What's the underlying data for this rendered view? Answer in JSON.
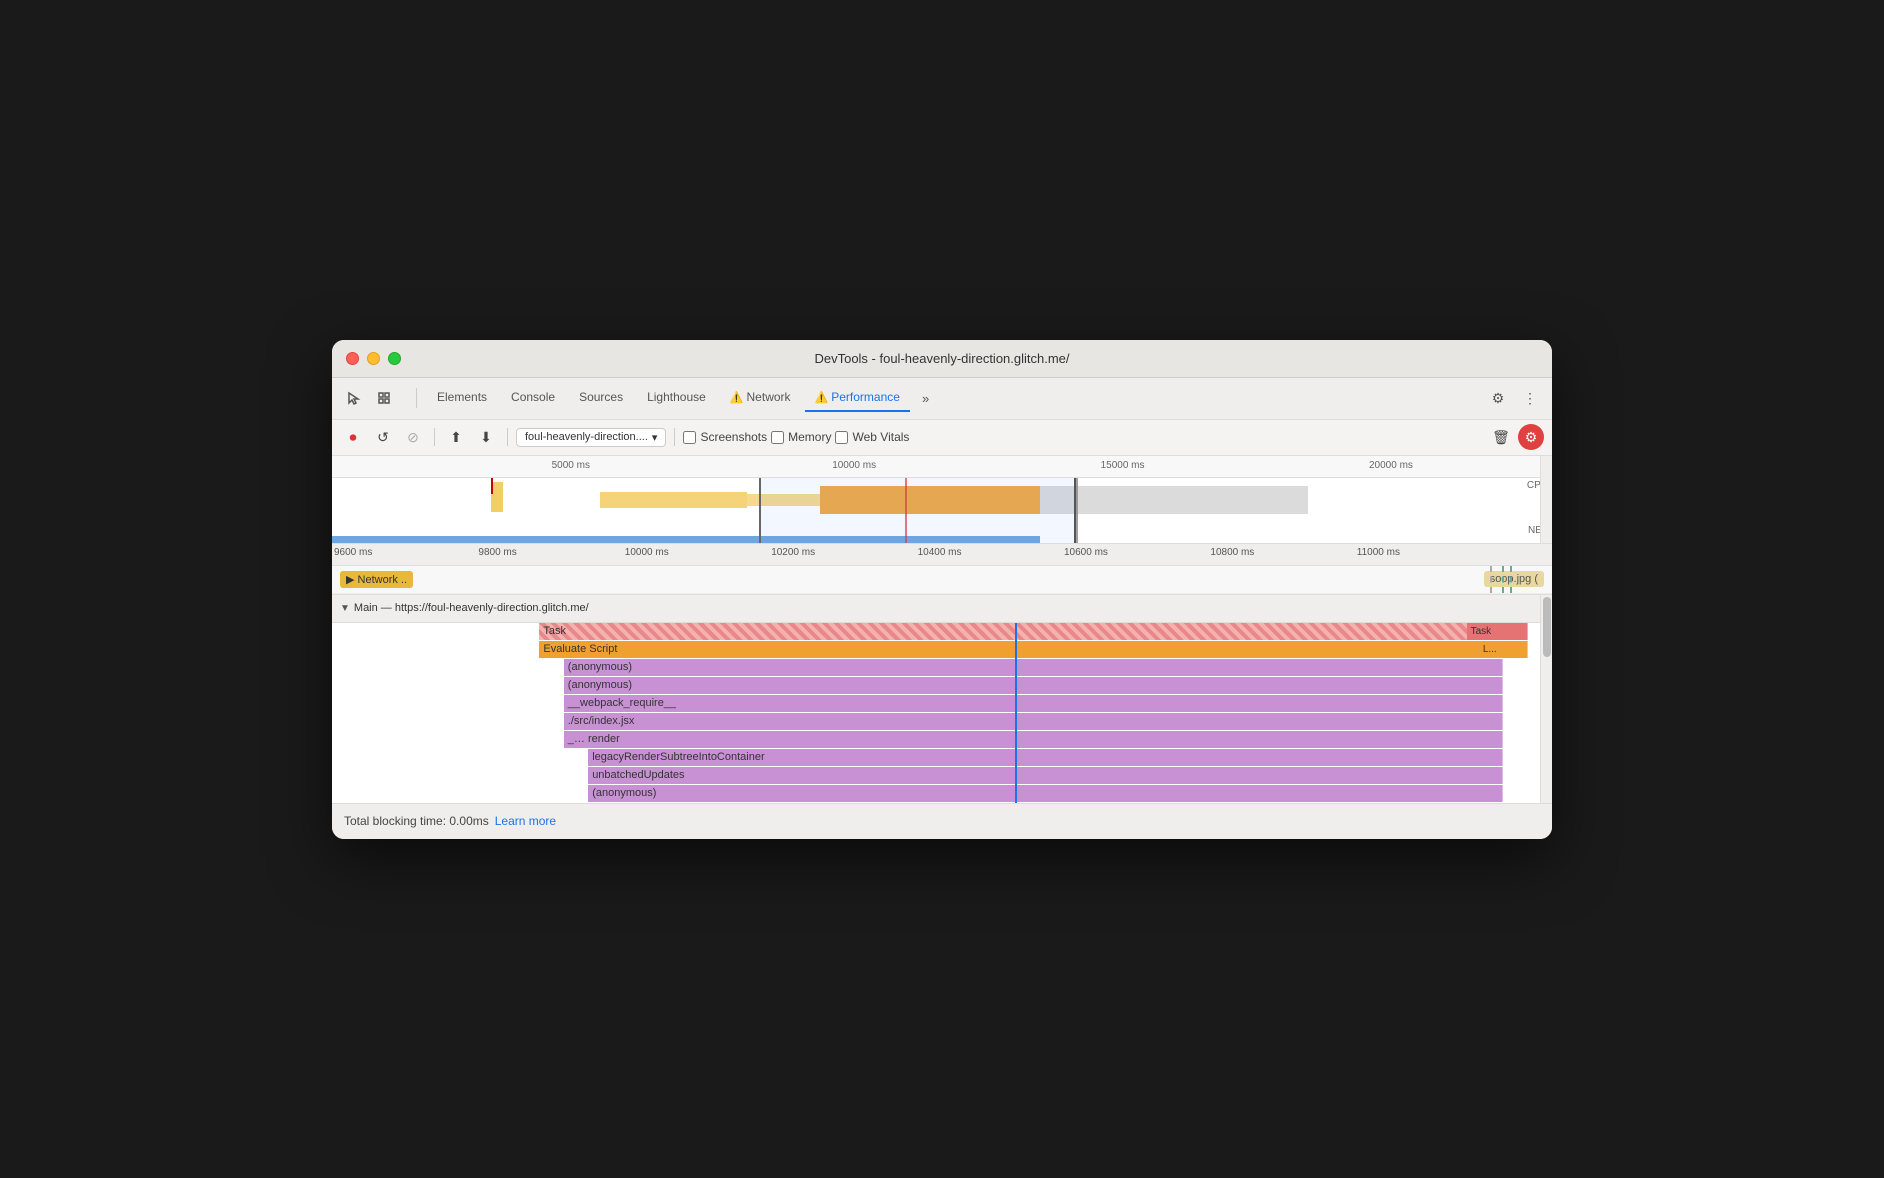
{
  "window": {
    "title": "DevTools - foul-heavenly-direction.glitch.me/"
  },
  "nav": {
    "tabs": [
      {
        "id": "elements",
        "label": "Elements",
        "active": false,
        "warning": false
      },
      {
        "id": "console",
        "label": "Console",
        "active": false,
        "warning": false
      },
      {
        "id": "sources",
        "label": "Sources",
        "active": false,
        "warning": false
      },
      {
        "id": "lighthouse",
        "label": "Lighthouse",
        "active": false,
        "warning": false
      },
      {
        "id": "network",
        "label": "Network",
        "active": false,
        "warning": true
      },
      {
        "id": "performance",
        "label": "Performance",
        "active": true,
        "warning": true
      }
    ],
    "more_label": "»"
  },
  "toolbar": {
    "url": "foul-heavenly-direction....",
    "screenshots_label": "Screenshots",
    "memory_label": "Memory",
    "web_vitals_label": "Web Vitals"
  },
  "timeline": {
    "ruler_labels": [
      "5000 ms",
      "10000 ms",
      "15000 ms",
      "20000 ms"
    ],
    "detail_ruler_labels": [
      "9600 ms",
      "9800 ms",
      "10000 ms",
      "10200 ms",
      "10400 ms",
      "10600 ms",
      "10800 ms",
      "11000 ms"
    ],
    "network_label": "▶ Network ..",
    "network_right_label": "soop.jpg (",
    "cpu_label": "CPU",
    "net_label": "NET"
  },
  "main": {
    "header": "Main — https://foul-heavenly-direction.glitch.me/",
    "rows": [
      {
        "label": "Task",
        "type": "task",
        "depth": 0
      },
      {
        "label": "Evaluate Script",
        "type": "evaluate",
        "depth": 1
      },
      {
        "label": "(anonymous)",
        "type": "call",
        "depth": 2
      },
      {
        "label": "(anonymous)",
        "type": "call",
        "depth": 2
      },
      {
        "label": "__webpack_require__",
        "type": "call",
        "depth": 2
      },
      {
        "label": "./src/index.jsx",
        "type": "call",
        "depth": 2
      },
      {
        "label": "_…  render",
        "type": "call",
        "depth": 2
      },
      {
        "label": "legacyRenderSubtreeIntoContainer",
        "type": "call",
        "depth": 3
      },
      {
        "label": "unbatchedUpdates",
        "type": "call",
        "depth": 3
      },
      {
        "label": "(anonymous)",
        "type": "call",
        "depth": 3
      }
    ],
    "task_right_label": "Task",
    "evaluate_right_label": "L..."
  },
  "status": {
    "blocking_time": "Total blocking time: 0.00ms",
    "learn_more": "Learn more"
  }
}
